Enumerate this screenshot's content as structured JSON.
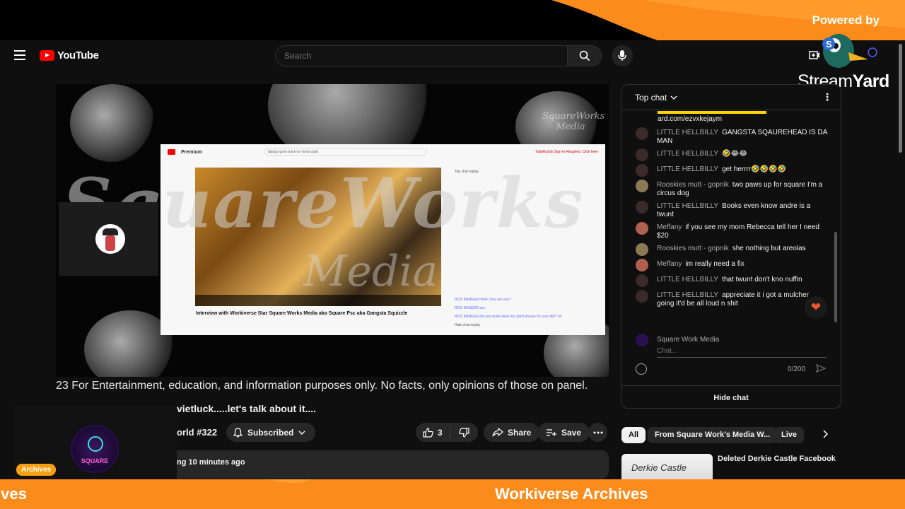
{
  "overlay": {
    "powered_by": "Powered by",
    "streamyard_light": "Stream",
    "streamyard_bold": "Yard"
  },
  "header": {
    "logo_text": "YouTube",
    "search_placeholder": "Search"
  },
  "video": {
    "watermark_main": "SquareWorks",
    "watermark_sub": "Media",
    "corner_logo": "SquareWorks Media",
    "inner": {
      "premium_label": "Premium",
      "search_text": "django goes back to nando paid",
      "alert_text": "TubeBuddy Sign-in Required. Click here",
      "chat_label": "Top chat replay",
      "video_title": "Interview with Workiverse Star Square Works Media aka Square Psc aka Gangsta Squizzle",
      "chat_lines": [
        "ROO BANGER  Hello, how are you?",
        "ROO BANGER  yes",
        "ROO BANGER  did you really steal my catch phrase for your title? lol"
      ],
      "hide_chat": "Hide chat replay"
    }
  },
  "below_video": {
    "ticker": "23 For Entertainment, education, and information purposes only. No facts, only opinions of those on panel.",
    "title_fragment": "vietluck.....let's talk about it....",
    "channel_fragment": "orld #322",
    "subscribed_label": "Subscribed",
    "like_count": "3",
    "share_label": "Share",
    "save_label": "Save",
    "desc_fragment": "ng 10 minutes ago"
  },
  "lower_left": {
    "logo_text": "SQUARE",
    "tag": "Archives"
  },
  "bottom_banner": {
    "left_text": "ives",
    "right_text": "Workiverse Archives"
  },
  "chat": {
    "header": "Top chat",
    "link_text": "ard.com/ezvxkejaym",
    "messages": [
      {
        "author": "LITTLE HELLBILLY",
        "text": "GANGSTA SQAUREHEAD IS DA MAN",
        "avatar_color": "#3a2a2a"
      },
      {
        "author": "LITTLE HELLBILLY",
        "text": "🤣😂😂",
        "avatar_color": "#3a2a2a"
      },
      {
        "author": "LITTLE HELLBILLY",
        "text": "get herrrr🤣🤣🤣🤣",
        "avatar_color": "#3a2a2a"
      },
      {
        "author": "Rooskies mutt - gopnik",
        "text": "two paws up for square I'm a circus dog",
        "avatar_color": "#8a7a55"
      },
      {
        "author": "LITTLE HELLBILLY",
        "text": "Books even know andre is a twunt",
        "avatar_color": "#3a2a2a"
      },
      {
        "author": "Meffany",
        "text": "if you see my mom Rebecca tell her I need $20",
        "avatar_color": "#b06050"
      },
      {
        "author": "Rooskies mutt - gopnik",
        "text": "she nothing but areolas",
        "avatar_color": "#8a7a55"
      },
      {
        "author": "Meffany",
        "text": "im really need a fix",
        "avatar_color": "#b06050"
      },
      {
        "author": "LITTLE HELLBILLY",
        "text": "that twunt don't kno nuffin",
        "avatar_color": "#3a2a2a"
      },
      {
        "author": "LITTLE HELLBILLY",
        "text": "appreciate it i got a mulcher going it'd be all loud n shit",
        "avatar_color": "#3a2a2a"
      }
    ],
    "input_user": "Square Work Media",
    "input_placeholder": "Chat...",
    "char_count": "0/200",
    "hide_chat": "Hide chat"
  },
  "chips": [
    "All",
    "From Square Work's Media W...",
    "Live"
  ],
  "recommendation": {
    "thumb_text": "Derkie Castle",
    "title": "Deleted Derkie Castle Facebook"
  },
  "colors": {
    "accent_orange": "#fb8c1c",
    "youtube_red": "#ff0000",
    "background": "#0f0f0f"
  }
}
